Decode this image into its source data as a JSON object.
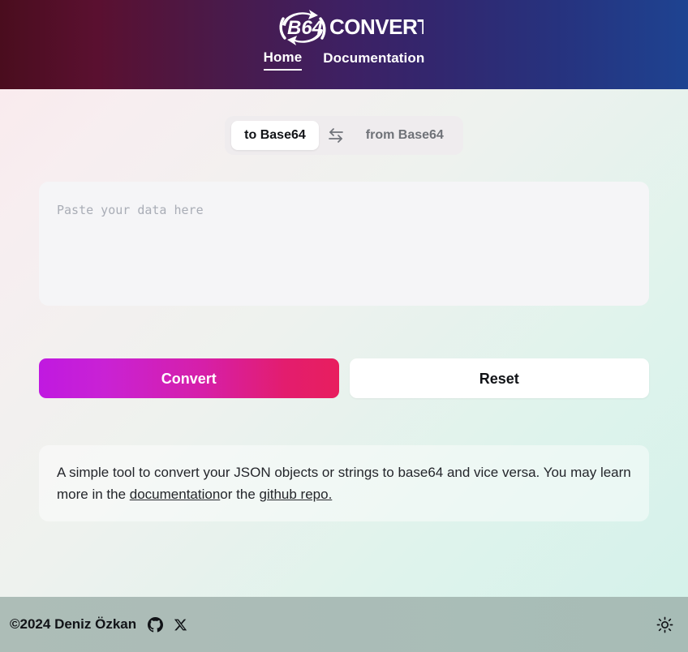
{
  "header": {
    "logo_text": "CONVERTER",
    "logo_mark": "B64",
    "logo_icon": "circular-arrows-icon",
    "nav": [
      {
        "label": "Home",
        "active": true
      },
      {
        "label": "Documentation",
        "active": false
      }
    ]
  },
  "converter": {
    "mode_toggle": {
      "to_label": "to Base64",
      "from_label": "from Base64",
      "selected": "to Base64",
      "swap_icon": "swap-arrows-icon"
    },
    "input": {
      "placeholder": "Paste your data here",
      "value": ""
    },
    "buttons": {
      "convert_label": "Convert",
      "reset_label": "Reset"
    }
  },
  "info": {
    "text_part_1": "A simple tool to convert your JSON objects or strings to base64 and vice versa. You may learn more in the ",
    "link_documentation": "documentation",
    "text_part_2": "or the ",
    "link_github": "github repo."
  },
  "footer": {
    "copyright": "©2024 Deniz Özkan",
    "github_icon": "github-icon",
    "x_icon": "x-twitter-icon",
    "theme_toggle_icon": "sun-icon"
  },
  "colors": {
    "header_gradient_start": "#4a0d1e",
    "header_gradient_end": "#1e4391",
    "convert_gradient_start": "#c019e0",
    "convert_gradient_end": "#e81e5e",
    "footer_bg": "#abbcb7",
    "toggle_bg": "#efecee",
    "input_bg": "#f5f5f7"
  }
}
